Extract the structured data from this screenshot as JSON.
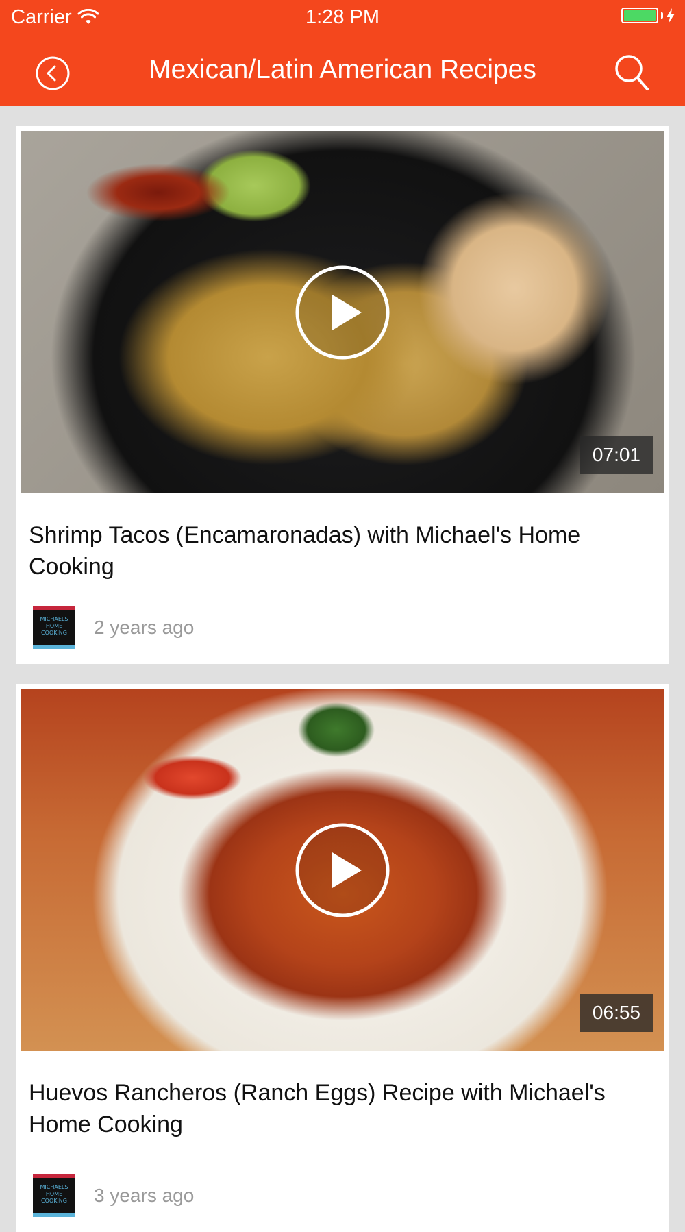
{
  "status_bar": {
    "carrier": "Carrier",
    "time": "1:28 PM",
    "battery_level": 1.0,
    "charging": true
  },
  "nav": {
    "title": "Mexican/Latin American Recipes",
    "back_icon": "back-circle-icon",
    "search_icon": "search-icon"
  },
  "colors": {
    "header_bg": "#f4471d",
    "feed_bg": "#e0e0e0",
    "battery_fill": "#4cd964"
  },
  "videos": [
    {
      "title": "Shrimp Tacos (Encamaronadas) with Michael's Home Cooking",
      "duration": "07:01",
      "published": "2 years ago",
      "channel_logo": "MICHAELS HOME COOKING"
    },
    {
      "title": "Huevos Rancheros (Ranch Eggs) Recipe with Michael's Home Cooking",
      "duration": "06:55",
      "published": "3 years ago",
      "channel_logo": "MICHAELS HOME COOKING"
    }
  ]
}
